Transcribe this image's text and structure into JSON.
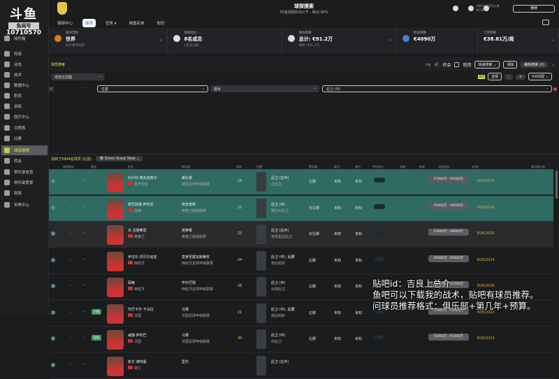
{
  "overlay_logo": {
    "brand": "斗鱼",
    "tag": "鱼闻号",
    "room": "10710570"
  },
  "sidebar": {
    "items": [
      {
        "label": "收件箱"
      },
      {
        "label": "阵容"
      },
      {
        "label": "动态"
      },
      {
        "label": "战术"
      },
      {
        "label": "数据中心"
      },
      {
        "label": "职员"
      },
      {
        "label": "训练"
      },
      {
        "label": "医疗中心"
      },
      {
        "label": "日程表"
      },
      {
        "label": "比赛"
      },
      {
        "label": "球探搜索"
      },
      {
        "label": "转会"
      },
      {
        "label": "俱乐部信息"
      },
      {
        "label": "俱乐部愿景"
      },
      {
        "label": "财政"
      },
      {
        "label": "世界中心"
      }
    ],
    "active": 10
  },
  "header": {
    "title": "球探搜索",
    "subtitle": "35名球探外出公干 - 熟识:90%",
    "date": "2021年7月5日 周四 16:00",
    "continue": "继续"
  },
  "nav": {
    "tabs": [
      "球探中心",
      "球员",
      "任务 ▾",
      "候选名单",
      "知识"
    ]
  },
  "cards": [
    {
      "label": "搜寻范围",
      "value": "世界",
      "sub": "较大搜寻范围"
    },
    {
      "label": "球探团队 ›",
      "value": "8名成员",
      "sub": "2名未分配"
    },
    {
      "label": "球探预算",
      "value": "总计: €91.2万",
      "sub": "剩余: €91.2万"
    },
    {
      "label": "转会预算",
      "value": "€4090万",
      "sub": ""
    },
    {
      "label": "工资预算",
      "value": "€38.81万/周",
      "sub": ""
    }
  ],
  "filters": {
    "section_label": "球员搜索",
    "interest": "兴趣",
    "transfer": "转会",
    "loan": "租借",
    "quick_search": "快速搜索",
    "clear": "清除",
    "edit_search": "编辑搜索 (0)",
    "add_filter": "增加过滤器",
    "attr_tag": "属性",
    "choose": "选择",
    "minus": "-",
    "plus": "+",
    "match": "0/0匹配",
    "rule_field": "位置",
    "rule_op": "擅长",
    "rule_value": "后卫 (中)"
  },
  "results": {
    "count_text": "找到了5904名球员 (过滤)",
    "view": "Emon Scout View"
  },
  "columns": [
    "球探建议",
    "报告",
    "姓名",
    "俱乐部",
    "年龄",
    "位置",
    "惯用脚",
    "能力",
    "潜力",
    "平均评分",
    "进球",
    "助攻",
    "转会身价",
    "▾合同",
    "青训俱乐部"
  ],
  "players": [
    {
      "name": "约什科·格瓦迪奥尔",
      "nation": "克罗地亚",
      "club": "莱比锡",
      "league": "德国足球甲级联赛",
      "age": "19",
      "pos": "后卫 (左中)",
      "role": "边后卫",
      "foot": "左脚",
      "ability": "未知",
      "potential": "未知",
      "rating": "-",
      "goals": "-",
      "assists": "-",
      "value": "€7600万 - €9300万",
      "contract": "30/6/2025",
      "tag": "",
      "style": "hl"
    },
    {
      "name": "穆罕默德·萨利苏",
      "nation": "加纳",
      "club": "南安普顿",
      "league": "英格兰超级联赛",
      "age": "22",
      "pos": "后卫 (中)",
      "role": "翼边中后卫",
      "foot": "仅左脚",
      "ability": "未知",
      "potential": "未知",
      "rating": "-",
      "goals": "-",
      "assists": "-",
      "value": "€3400万 - €8200万",
      "contract": "30/6/2024",
      "tag": "",
      "style": "hl"
    },
    {
      "name": "本·戈德弗雷",
      "nation": "英格兰",
      "club": "埃弗顿",
      "league": "英格兰超级联赛",
      "age": "23",
      "pos": "后卫 (右中)",
      "role": "进攻型边后卫",
      "foot": "仅右脚",
      "ability": "未知",
      "potential": "未知",
      "rating": "-",
      "goals": "-",
      "assists": "-",
      "value": "€3000万 - €8000万",
      "contract": "30/6/2025",
      "tag": "",
      "style": "grey"
    },
    {
      "name": "伊戈尔·苏贝尔迪亚",
      "nation": "西班牙",
      "club": "皇家圣塞瓦斯蒂安",
      "league": "西班牙足球甲级联赛",
      "age": "24",
      "pos": "后卫 (中), 后腰",
      "role": "拖后组织",
      "foot": "右脚",
      "ability": "未知",
      "potential": "未知",
      "rating": "-",
      "goals": "-",
      "assists": "-",
      "value": "€4000万 - €6400万",
      "contract": "30/6/2024",
      "tag": "",
      "style": ""
    },
    {
      "name": "耶赖",
      "nation": "西班牙",
      "club": "毕尔巴鄂",
      "league": "西班牙足球甲级联赛",
      "age": "26",
      "pos": "后卫 (中)",
      "role": "出球后卫",
      "foot": "右脚",
      "ability": "未知",
      "potential": "未知",
      "rating": "-",
      "goals": "-",
      "assists": "-",
      "value": "€4000万 - €5200万",
      "contract": "30/6/2026",
      "tag": "",
      "style": ""
    },
    {
      "name": "布巴卡尔·卡马拉",
      "nation": "法国",
      "club": "马赛",
      "league": "法国足球甲级联赛",
      "age": "21",
      "pos": "后卫 (中), 后腰",
      "role": "拖后组织",
      "foot": "右脚",
      "ability": "未知",
      "potential": "未知",
      "rating": "-",
      "goals": "-",
      "assists": "-",
      "value": "€3900万 - €6300万",
      "contract": "30/6/2022",
      "tag": "兴趣",
      "style": ""
    },
    {
      "name": "威廉·萨利巴",
      "nation": "法国",
      "club": "马赛",
      "league": "法国足球甲级联赛",
      "age": "20",
      "pos": "后卫 (中)",
      "role": "中后卫",
      "foot": "右脚",
      "ability": "未知",
      "potential": "未知",
      "rating": "-",
      "goals": "-",
      "assists": "-",
      "value": "€3000万 - €5400万",
      "contract": "30/6/2024",
      "tag": "租借",
      "style": ""
    },
    {
      "name": "斯文·博特曼",
      "nation": "荷兰",
      "club": "里尔",
      "league": "",
      "age": "",
      "pos": "后卫 (左中)",
      "role": "",
      "foot": "",
      "ability": "",
      "potential": "",
      "rating": "",
      "goals": "",
      "assists": "",
      "value": "",
      "contract": "",
      "tag": "",
      "style": ""
    }
  ],
  "stream_overlay": [
    "贴吧id：吉良上总介",
    "鱼吧可以下载我的战术，贴吧有球员推荐。",
    "问球员推荐格式：俱乐部+第几年+预算。"
  ],
  "colors": {
    "accent": "#d8e84a",
    "highlight_row": "#2f6b63",
    "contract": "#e0b030"
  }
}
